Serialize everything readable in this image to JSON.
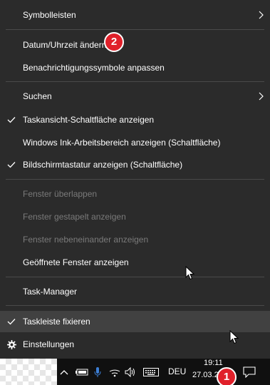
{
  "menu": {
    "items": [
      {
        "label": "Symbolleisten",
        "checked": false,
        "submenu": true,
        "disabled": false
      },
      {
        "label": "Datum/Uhrzeit ändern",
        "checked": false,
        "submenu": false,
        "disabled": false
      },
      {
        "label": "Benachrichtigungssymbole anpassen",
        "checked": false,
        "submenu": false,
        "disabled": false
      },
      {
        "label": "Suchen",
        "checked": false,
        "submenu": true,
        "disabled": false
      },
      {
        "label": "Taskansicht-Schaltfläche anzeigen",
        "checked": true,
        "submenu": false,
        "disabled": false
      },
      {
        "label": "Windows Ink-Arbeitsbereich anzeigen (Schaltfläche)",
        "checked": false,
        "submenu": false,
        "disabled": false
      },
      {
        "label": "Bildschirmtastatur anzeigen (Schaltfläche)",
        "checked": true,
        "submenu": false,
        "disabled": false
      },
      {
        "label": "Fenster überlappen",
        "checked": false,
        "submenu": false,
        "disabled": true
      },
      {
        "label": "Fenster gestapelt anzeigen",
        "checked": false,
        "submenu": false,
        "disabled": true
      },
      {
        "label": "Fenster nebeneinander anzeigen",
        "checked": false,
        "submenu": false,
        "disabled": true
      },
      {
        "label": "Geöffnete Fenster anzeigen",
        "checked": false,
        "submenu": false,
        "disabled": false
      },
      {
        "label": "Task-Manager",
        "checked": false,
        "submenu": false,
        "disabled": false
      },
      {
        "label": "Taskleiste fixieren",
        "checked": true,
        "submenu": false,
        "disabled": false,
        "highlighted": true
      },
      {
        "label": "Einstellungen",
        "checked": false,
        "submenu": false,
        "disabled": false,
        "icon": "gear-icon"
      }
    ]
  },
  "badges": {
    "step_1": "1",
    "step_2": "2"
  },
  "taskbar": {
    "tray_icons": [
      "chevron-up-icon",
      "battery-icon",
      "microphone-icon",
      "wifi-icon",
      "speaker-icon",
      "keyboard-icon"
    ],
    "language": "DEU",
    "time": "19:11",
    "date": "27.03.2",
    "action_center_icon": "notification-icon"
  },
  "colors": {
    "menu_background": "#2b2b2b",
    "menu_hover": "#414141",
    "disabled_text": "#7a7a7a",
    "badge": "#e0202a",
    "taskbar": "#101010"
  }
}
